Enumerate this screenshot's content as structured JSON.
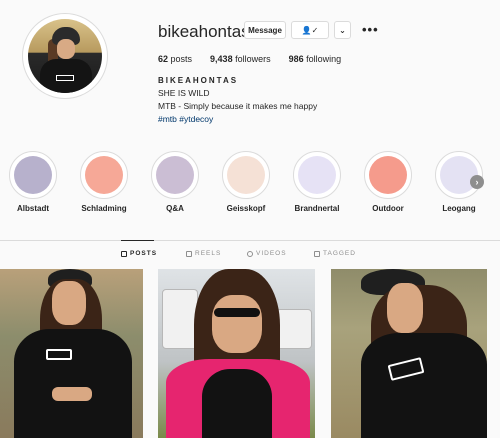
{
  "profile": {
    "username": "bikeahontas",
    "message_label": "Message",
    "follow_icon_label": "👤✓",
    "dropdown_label": "⌄",
    "more_label": "•••"
  },
  "stats": {
    "posts_count": "62",
    "posts_label": "posts",
    "followers_count": "9,438",
    "followers_label": "followers",
    "following_count": "986",
    "following_label": "following"
  },
  "bio": {
    "name": "BIKEAHONTAS",
    "line1": "SHE IS WILD",
    "line2": "MTB - Simply because it makes me happy",
    "tags": "#mtb #ytdecoy"
  },
  "highlights": [
    {
      "label": "Albstadt",
      "color": "#b7b1cc"
    },
    {
      "label": "Schladming",
      "color": "#f6a897"
    },
    {
      "label": "Q&A",
      "color": "#cbbed4"
    },
    {
      "label": "Geisskopf",
      "color": "#f5e1d6"
    },
    {
      "label": "Brandnertal",
      "color": "#e6e2f5"
    },
    {
      "label": "Outdoor",
      "color": "#f59b8c"
    },
    {
      "label": "Leogang",
      "color": "#e4e2f3"
    }
  ],
  "tabs": {
    "posts": "POSTS",
    "reels": "REELS",
    "videos": "VIDEOS",
    "tagged": "TAGGED"
  }
}
